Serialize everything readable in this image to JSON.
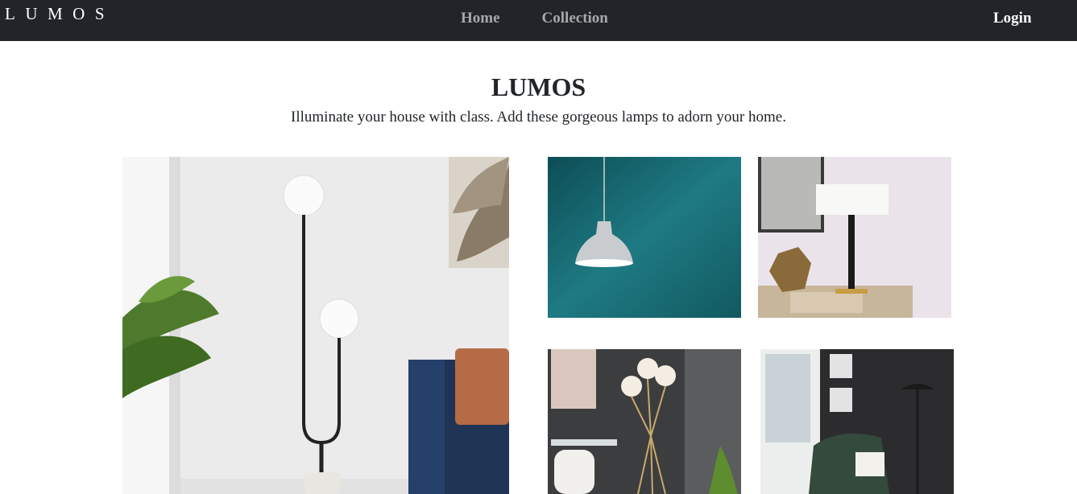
{
  "navbar": {
    "brand": "LUMOS",
    "links": [
      {
        "label": "Home"
      },
      {
        "label": "Collection"
      }
    ],
    "login": "Login"
  },
  "hero": {
    "title": "LUMOS",
    "subtitle": "Illuminate your house with class. Add these gorgeous lamps to adorn your home."
  },
  "colors": {
    "navbar_bg": "#212529",
    "nav_link": "#a6a8aa",
    "text": "#212529"
  }
}
